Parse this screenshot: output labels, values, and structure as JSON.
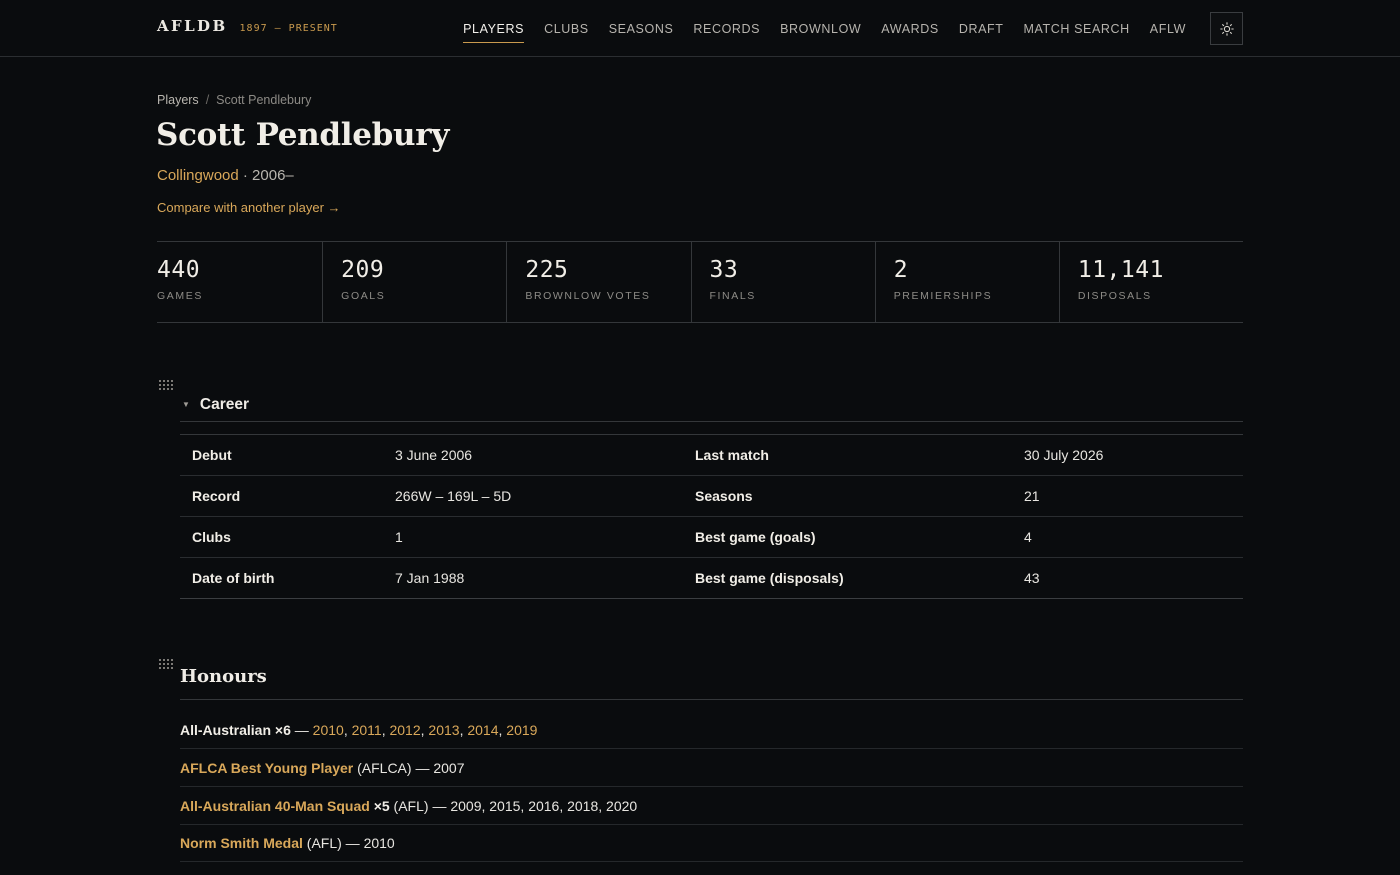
{
  "brand": {
    "name": "AFLDB",
    "years": "1897 — PRESENT"
  },
  "nav": [
    "PLAYERS",
    "CLUBS",
    "SEASONS",
    "RECORDS",
    "BROWNLOW",
    "AWARDS",
    "DRAFT",
    "MATCH SEARCH",
    "AFLW"
  ],
  "nav_active": "PLAYERS",
  "theme_toggle_icon": "sun-icon",
  "breadcrumb": {
    "root": "Players",
    "sep": "/",
    "current": "Scott Pendlebury"
  },
  "player": {
    "name": "Scott Pendlebury",
    "club": "Collingwood",
    "years": " · 2006–",
    "compare_link": "Compare with another player →"
  },
  "stats": [
    {
      "value": "440",
      "label": "GAMES"
    },
    {
      "value": "209",
      "label": "GOALS"
    },
    {
      "value": "225",
      "label": "BROWNLOW VOTES"
    },
    {
      "value": "33",
      "label": "FINALS"
    },
    {
      "value": "2",
      "label": "PREMIERSHIPS"
    },
    {
      "value": "11,141",
      "label": "DISPOSALS"
    }
  ],
  "career": {
    "title": "Career",
    "rows": [
      {
        "k1": "Debut",
        "v1": "3 June 2006",
        "k2": "Last match",
        "v2": "30 July 2026"
      },
      {
        "k1": "Record",
        "v1": "266W – 169L – 5D",
        "k2": "Seasons",
        "v2": "21"
      },
      {
        "k1": "Clubs",
        "v1": "1",
        "k2": "Best game (goals)",
        "v2": "4"
      },
      {
        "k1": "Date of birth",
        "v1": "7 Jan 1988",
        "k2": "Best game (disposals)",
        "v2": "43"
      }
    ]
  },
  "honours": {
    "title": "Honours",
    "all_australian": {
      "label": "All-Australian ×6",
      "dash": " — ",
      "years": [
        "2010",
        "2011",
        "2012",
        "2013",
        "2014",
        "2019"
      ]
    },
    "items": [
      {
        "name": "AFLCA Best Young Player",
        "mult": "",
        "rest": " (AFLCA) — 2007"
      },
      {
        "name": "All-Australian 40-Man Squad",
        "mult": " ×5",
        "rest": " (AFL) — 2009, 2015, 2016, 2018, 2020"
      },
      {
        "name": "Norm Smith Medal",
        "mult": "",
        "rest": " (AFL) — 2010"
      }
    ]
  }
}
